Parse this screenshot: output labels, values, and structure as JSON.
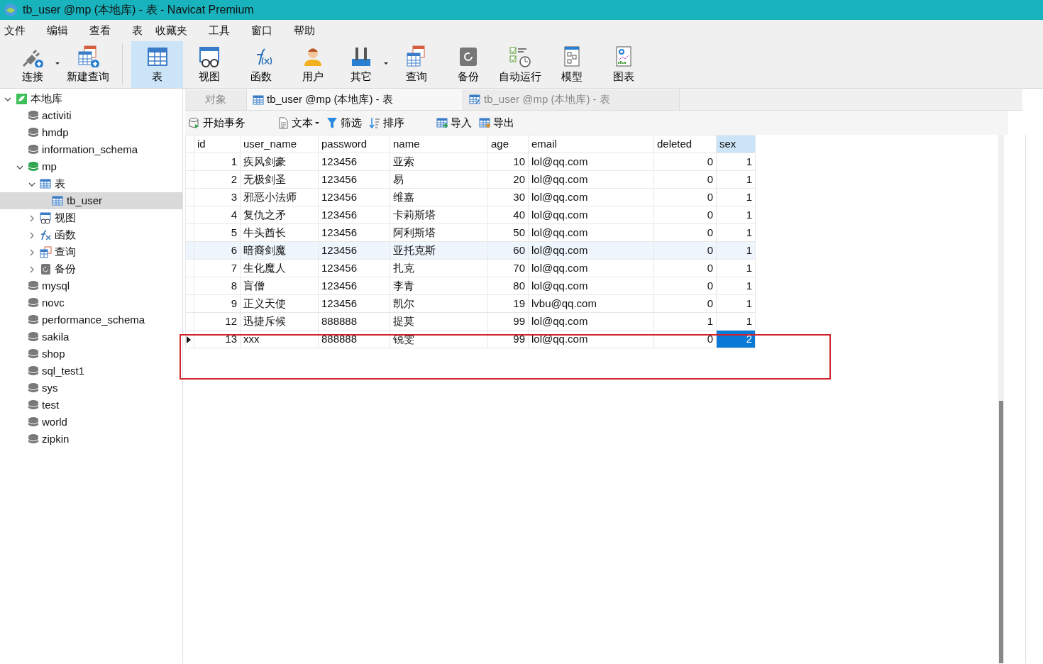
{
  "window": {
    "title": "tb_user @mp (本地库) - 表 - Navicat Premium"
  },
  "menu": [
    "文件",
    "编辑",
    "查看",
    "表",
    "收藏夹",
    "工具",
    "窗口",
    "帮助"
  ],
  "toolbar": [
    {
      "label": "连接",
      "kind": "connect",
      "selected": false,
      "dropdown": true
    },
    {
      "label": "新建查询",
      "kind": "newquery",
      "selected": false,
      "dropdown": false
    },
    {
      "label": "表",
      "kind": "table",
      "selected": true,
      "dropdown": false
    },
    {
      "label": "视图",
      "kind": "view",
      "selected": false,
      "dropdown": false
    },
    {
      "label": "函数",
      "kind": "function",
      "selected": false,
      "dropdown": false
    },
    {
      "label": "用户",
      "kind": "user",
      "selected": false,
      "dropdown": false
    },
    {
      "label": "其它",
      "kind": "tools",
      "selected": false,
      "dropdown": true
    },
    {
      "label": "查询",
      "kind": "query",
      "selected": false,
      "dropdown": false
    },
    {
      "label": "备份",
      "kind": "backup",
      "selected": false,
      "dropdown": false
    },
    {
      "label": "自动运行",
      "kind": "schedule",
      "selected": false,
      "dropdown": false
    },
    {
      "label": "模型",
      "kind": "model",
      "selected": false,
      "dropdown": false
    },
    {
      "label": "图表",
      "kind": "chart",
      "selected": false,
      "dropdown": false
    }
  ],
  "sidebar": {
    "items": [
      {
        "label": "本地库",
        "kind": "connection",
        "expanded": true,
        "selected": false,
        "children": [
          {
            "label": "activiti",
            "kind": "database",
            "open": false,
            "selected": false
          },
          {
            "label": "hmdp",
            "kind": "database",
            "open": false,
            "selected": false
          },
          {
            "label": "information_schema",
            "kind": "database",
            "open": false,
            "selected": false
          },
          {
            "label": "mp",
            "kind": "database",
            "open": true,
            "expanded": true,
            "selected": false,
            "children": [
              {
                "label": "表",
                "kind": "table",
                "expanded": true,
                "selected": false,
                "children": [
                  {
                    "label": "tb_user",
                    "kind": "table",
                    "selected": true
                  }
                ]
              },
              {
                "label": "视图",
                "kind": "view",
                "expanded": false,
                "selected": false
              },
              {
                "label": "函数",
                "kind": "function",
                "expanded": false,
                "selected": false
              },
              {
                "label": "查询",
                "kind": "query",
                "expanded": false,
                "selected": false
              },
              {
                "label": "备份",
                "kind": "backup",
                "expanded": false,
                "selected": false
              }
            ]
          },
          {
            "label": "mysql",
            "kind": "database",
            "open": false,
            "selected": false
          },
          {
            "label": "novc",
            "kind": "database",
            "open": false,
            "selected": false
          },
          {
            "label": "performance_schema",
            "kind": "database",
            "open": false,
            "selected": false
          },
          {
            "label": "sakila",
            "kind": "database",
            "open": false,
            "selected": false
          },
          {
            "label": "shop",
            "kind": "database",
            "open": false,
            "selected": false
          },
          {
            "label": "sql_test1",
            "kind": "database",
            "open": false,
            "selected": false
          },
          {
            "label": "sys",
            "kind": "database",
            "open": false,
            "selected": false
          },
          {
            "label": "test",
            "kind": "database",
            "open": false,
            "selected": false
          },
          {
            "label": "world",
            "kind": "database",
            "open": false,
            "selected": false
          },
          {
            "label": "zipkin",
            "kind": "database",
            "open": false,
            "selected": false
          }
        ]
      }
    ]
  },
  "tabs": [
    {
      "label": "对象",
      "kind": "plain",
      "selected": false
    },
    {
      "label": "tb_user @mp (本地库) - 表",
      "kind": "table",
      "selected": true
    },
    {
      "label": "tb_user @mp (本地库) - 表",
      "kind": "design",
      "selected": false
    }
  ],
  "actions": [
    {
      "label": "开始事务",
      "kind": "transaction",
      "dropdown": false
    },
    {
      "label": "文本",
      "kind": "text",
      "dropdown": true
    },
    {
      "label": "筛选",
      "kind": "filter",
      "dropdown": false
    },
    {
      "label": "排序",
      "kind": "sort",
      "dropdown": false
    },
    {
      "label": "导入",
      "kind": "import",
      "dropdown": false
    },
    {
      "label": "导出",
      "kind": "export",
      "dropdown": false
    }
  ],
  "table": {
    "columns": [
      {
        "name": "id",
        "kind": "number",
        "selected": false
      },
      {
        "name": "user_name",
        "kind": "text",
        "selected": false
      },
      {
        "name": "password",
        "kind": "text",
        "selected": false
      },
      {
        "name": "name",
        "kind": "text",
        "selected": false
      },
      {
        "name": "age",
        "kind": "number",
        "selected": false
      },
      {
        "name": "email",
        "kind": "text",
        "selected": false
      },
      {
        "name": "deleted",
        "kind": "number",
        "selected": false
      },
      {
        "name": "sex",
        "kind": "number",
        "selected": true
      }
    ],
    "rows": [
      {
        "cells": [
          "1",
          "疾风剑豪",
          "123456",
          "亚索",
          "10",
          "lol@qq.com",
          "0",
          "1"
        ],
        "selected": false,
        "hovered": false,
        "highlighted": false
      },
      {
        "cells": [
          "2",
          "无极剑圣",
          "123456",
          "易",
          "20",
          "lol@qq.com",
          "0",
          "1"
        ],
        "selected": false,
        "hovered": false,
        "highlighted": false
      },
      {
        "cells": [
          "3",
          "邪恶小法师",
          "123456",
          "维嘉",
          "30",
          "lol@qq.com",
          "0",
          "1"
        ],
        "selected": false,
        "hovered": false,
        "highlighted": false
      },
      {
        "cells": [
          "4",
          "复仇之矛",
          "123456",
          "卡莉斯塔",
          "40",
          "lol@qq.com",
          "0",
          "1"
        ],
        "selected": false,
        "hovered": false,
        "highlighted": false
      },
      {
        "cells": [
          "5",
          "牛头酋长",
          "123456",
          "阿利斯塔",
          "50",
          "lol@qq.com",
          "0",
          "1"
        ],
        "selected": false,
        "hovered": false,
        "highlighted": false
      },
      {
        "cells": [
          "6",
          "暗裔剑魔",
          "123456",
          "亚托克斯",
          "60",
          "lol@qq.com",
          "0",
          "1"
        ],
        "selected": false,
        "hovered": true,
        "highlighted": false
      },
      {
        "cells": [
          "7",
          "生化魔人",
          "123456",
          "扎克",
          "70",
          "lol@qq.com",
          "0",
          "1"
        ],
        "selected": false,
        "hovered": false,
        "highlighted": false
      },
      {
        "cells": [
          "8",
          "盲僧",
          "123456",
          "李青",
          "80",
          "lol@qq.com",
          "0",
          "1"
        ],
        "selected": false,
        "hovered": false,
        "highlighted": false
      },
      {
        "cells": [
          "9",
          "正义天使",
          "123456",
          "凯尔",
          "19",
          "lvbu@qq.com",
          "0",
          "1"
        ],
        "selected": false,
        "hovered": false,
        "highlighted": false
      },
      {
        "cells": [
          "12",
          "迅捷斥候",
          "888888",
          "提莫",
          "99",
          "lol@qq.com",
          "1",
          "1"
        ],
        "selected": false,
        "hovered": false,
        "highlighted": false
      },
      {
        "cells": [
          "13",
          "xxx",
          "888888",
          "锐雯",
          "99",
          "lol@qq.com",
          "0",
          "2"
        ],
        "selected": true,
        "hovered": false,
        "highlighted": true
      }
    ]
  }
}
